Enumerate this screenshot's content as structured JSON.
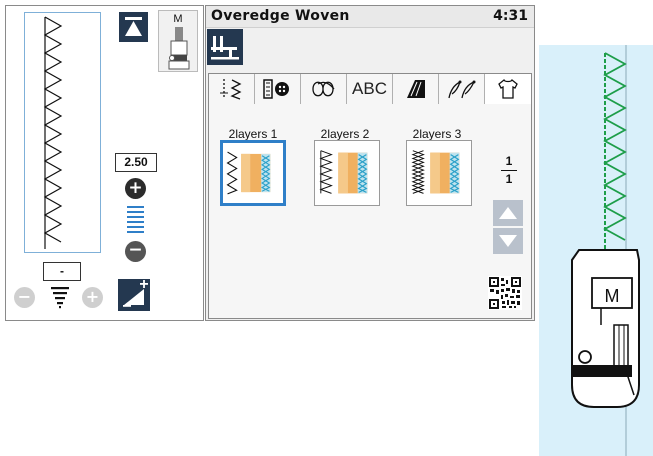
{
  "header": {
    "title": "Overedge Woven",
    "clock": "4:31"
  },
  "stitch_settings": {
    "width_value": "2.50",
    "length_value": "-",
    "presser_foot": "M"
  },
  "tabs": [
    {
      "icon": "utility-stitch-icon"
    },
    {
      "icon": "buttonhole-icon"
    },
    {
      "icon": "decorative-stitch-icon"
    },
    {
      "label": "ABC"
    },
    {
      "icon": "satin-stitch-icon"
    },
    {
      "icon": "heirloom-stitch-icon"
    },
    {
      "icon": "shirt-icon",
      "active": true
    }
  ],
  "patterns": [
    {
      "label": "2layers 1",
      "selected": true
    },
    {
      "label": "2layers 2"
    },
    {
      "label": "2layers 3"
    }
  ],
  "pagination": {
    "current": "1",
    "total": "1"
  },
  "illustration": {
    "foot_letter": "M"
  },
  "colors": {
    "accent_dark": "#243850",
    "selection": "#2f7fc8",
    "fabric": "#d9f0fa",
    "stitch_green": "#1e9e4a",
    "fabric_swatch": "#f0b060"
  }
}
